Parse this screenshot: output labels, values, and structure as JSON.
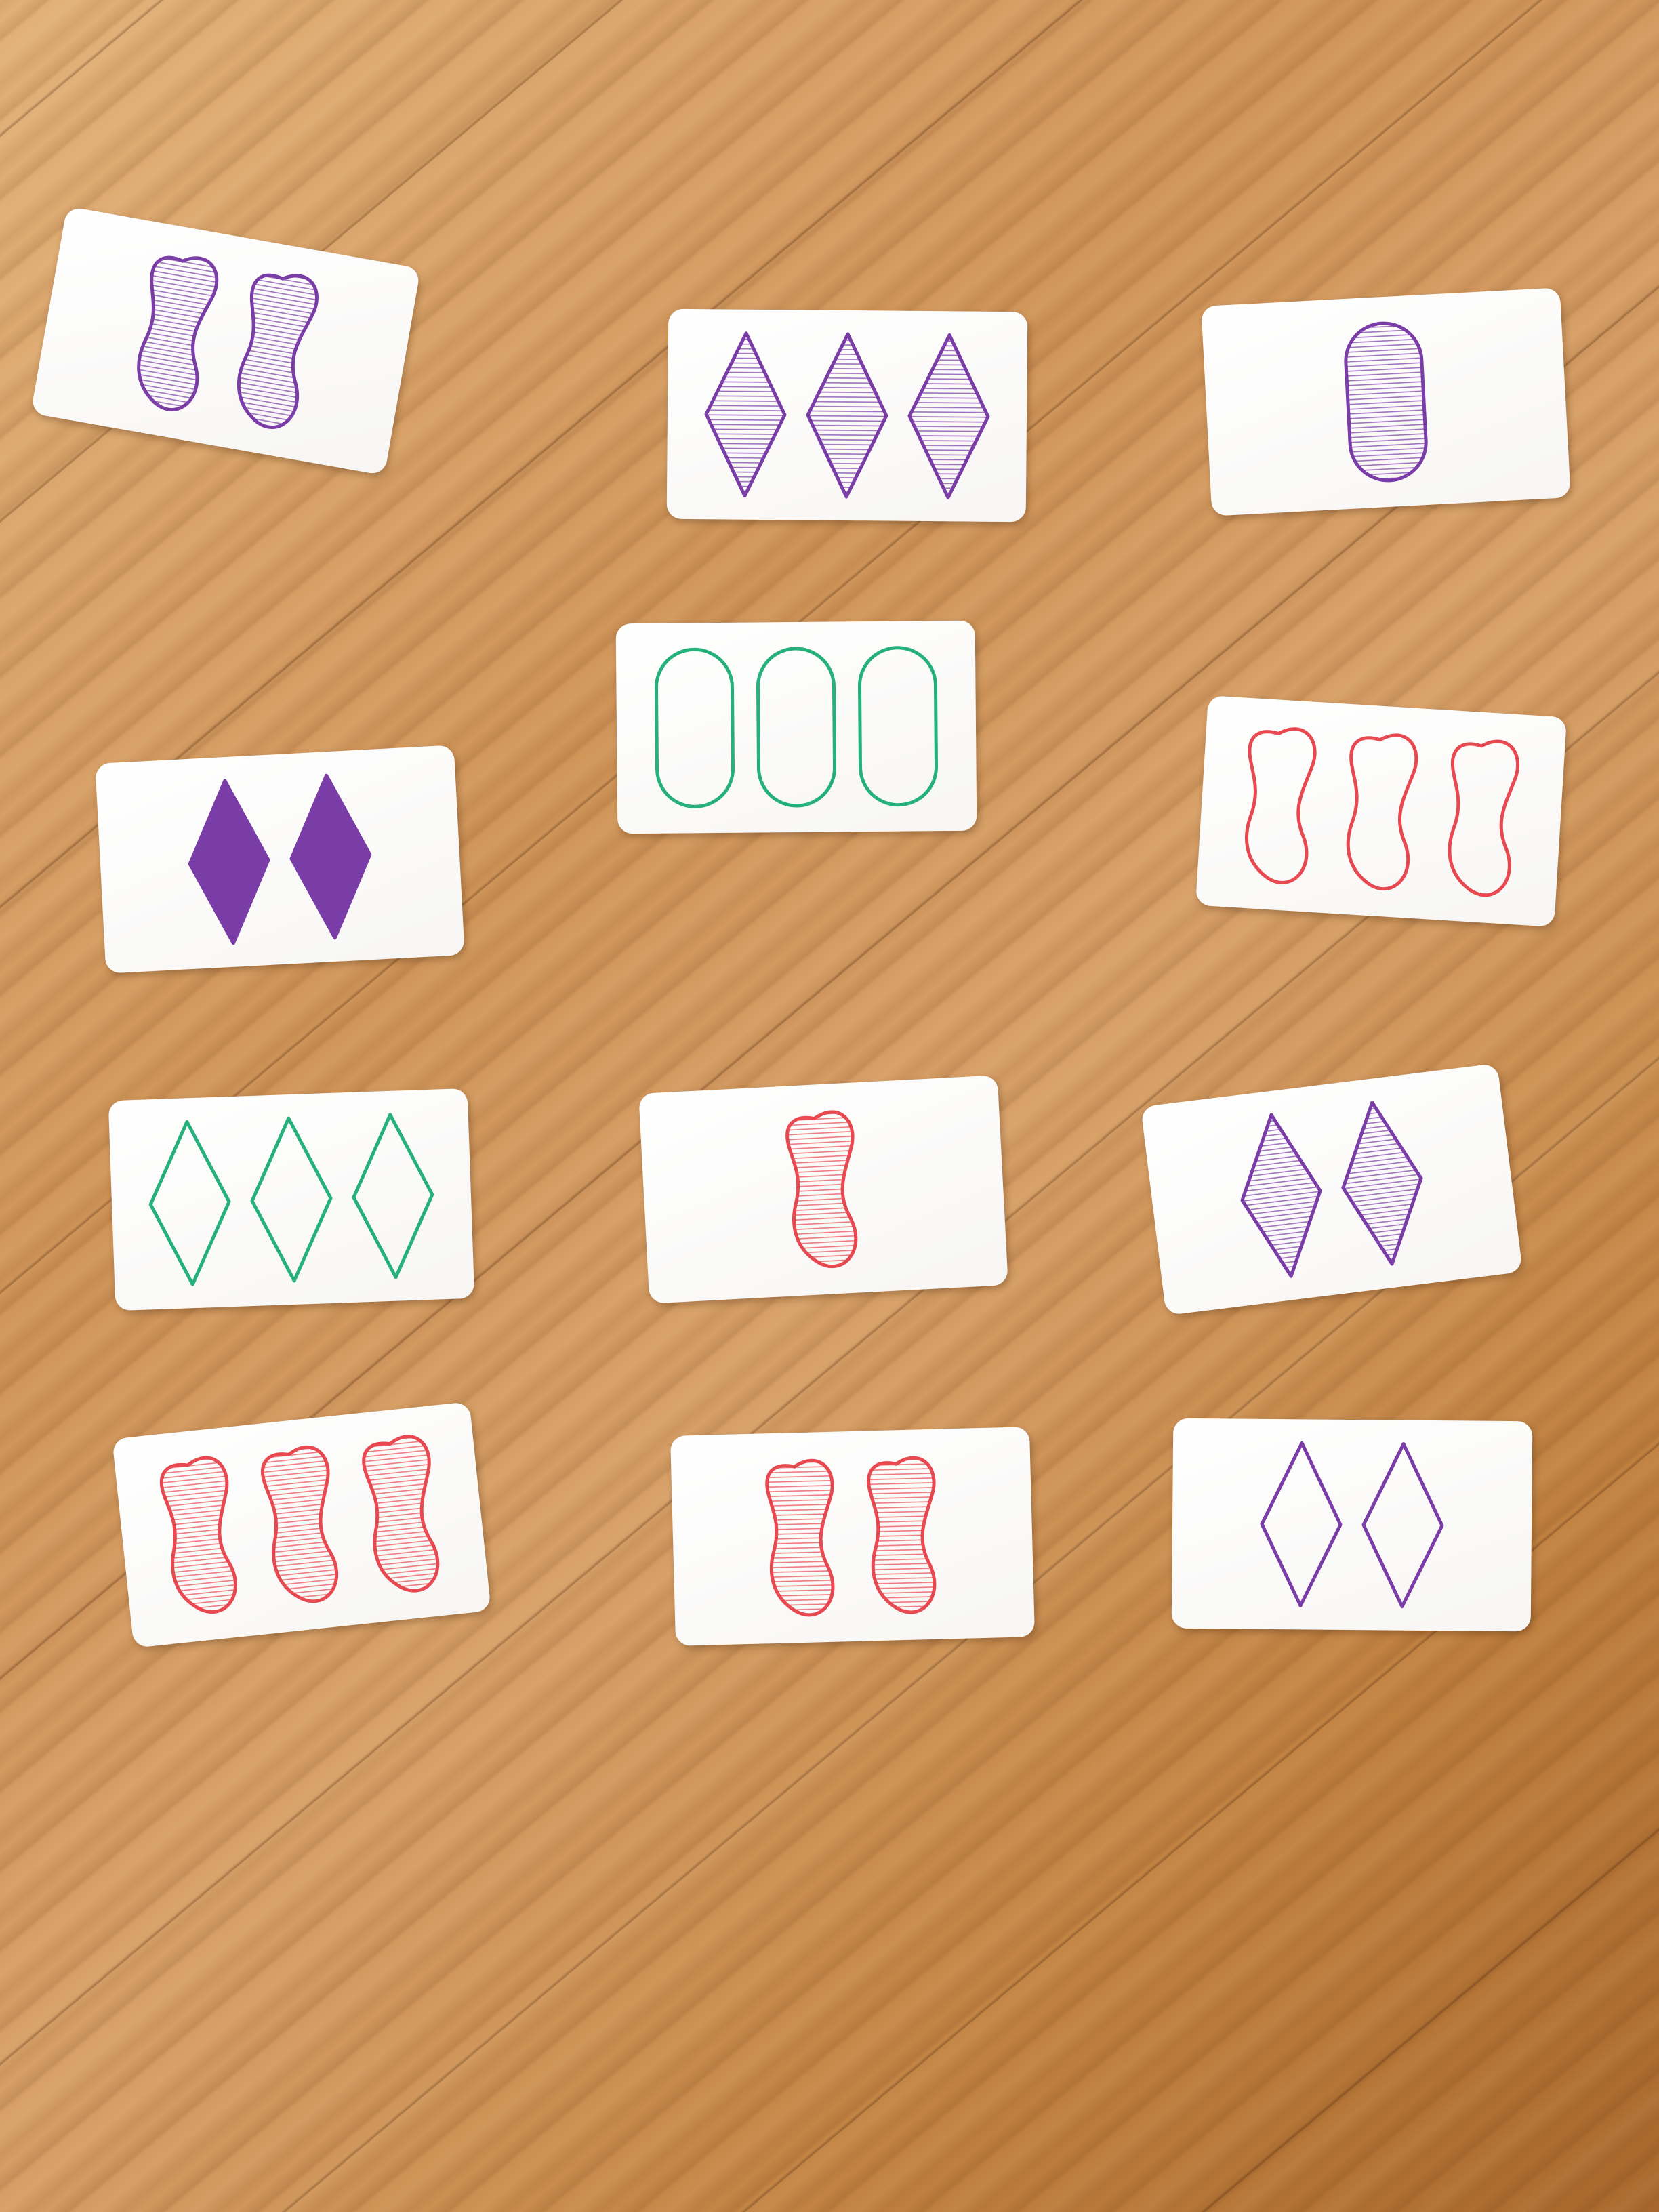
{
  "colors": {
    "purple": "#7a3ca6",
    "green": "#25b07c",
    "red": "#e84850"
  },
  "cards": [
    {
      "number": 2,
      "shape": "squiggle",
      "color": "purple",
      "shading": "striped"
    },
    {
      "number": 3,
      "shape": "diamond",
      "color": "purple",
      "shading": "striped"
    },
    {
      "number": 1,
      "shape": "oval",
      "color": "purple",
      "shading": "striped"
    },
    {
      "number": 3,
      "shape": "oval",
      "color": "green",
      "shading": "open"
    },
    {
      "number": 2,
      "shape": "diamond",
      "color": "purple",
      "shading": "solid"
    },
    {
      "number": 3,
      "shape": "squiggle",
      "color": "red",
      "shading": "open"
    },
    {
      "number": 3,
      "shape": "diamond",
      "color": "green",
      "shading": "open"
    },
    {
      "number": 1,
      "shape": "squiggle",
      "color": "red",
      "shading": "striped"
    },
    {
      "number": 2,
      "shape": "diamond",
      "color": "purple",
      "shading": "striped"
    },
    {
      "number": 3,
      "shape": "squiggle",
      "color": "red",
      "shading": "striped"
    },
    {
      "number": 2,
      "shape": "squiggle",
      "color": "red",
      "shading": "striped"
    },
    {
      "number": 2,
      "shape": "diamond",
      "color": "purple",
      "shading": "open"
    }
  ]
}
